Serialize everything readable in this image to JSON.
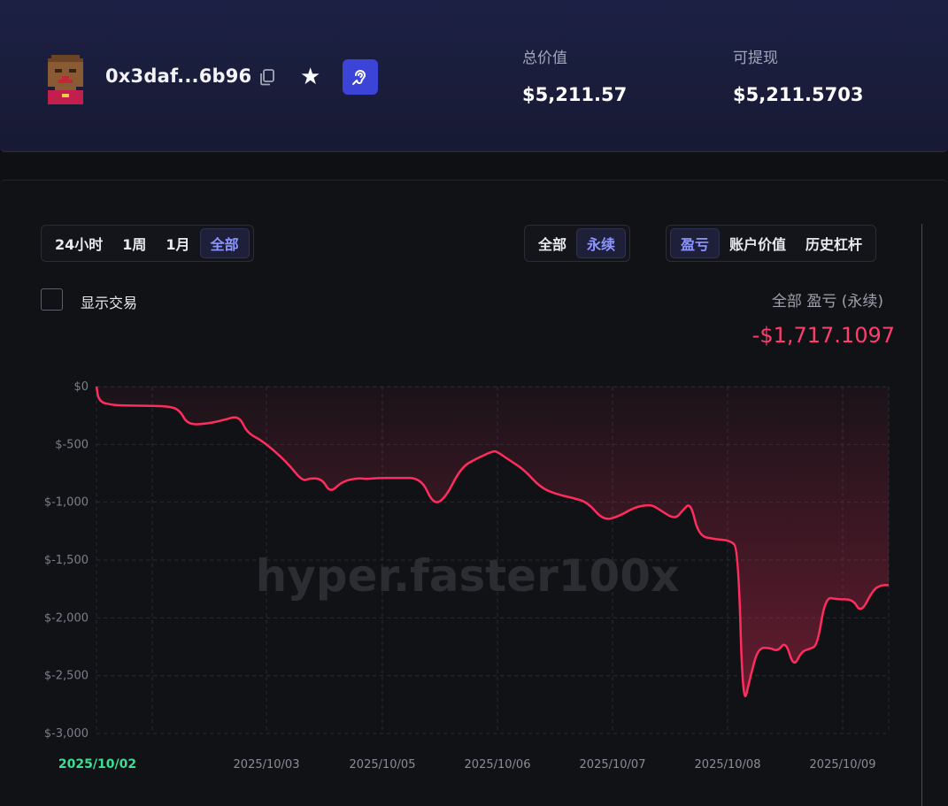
{
  "header": {
    "address": "0x3daf...6b96",
    "total_value_label": "总价值",
    "total_value": "$5,211.57",
    "withdrawable_label": "可提现",
    "withdrawable": "$5,211.5703"
  },
  "icons": {
    "copy": "copy-icon",
    "star": "star-icon",
    "ear": "ear-icon",
    "avatar": "pixel-avatar"
  },
  "controls": {
    "time_ranges": [
      "24小时",
      "1周",
      "1月",
      "全部"
    ],
    "time_active": "全部",
    "market_types": [
      "全部",
      "永续"
    ],
    "market_active": "永续",
    "metrics": [
      "盈亏",
      "账户价值",
      "历史杠杆"
    ],
    "metric_active": "盈亏",
    "show_trades_label": "显示交易"
  },
  "summary": {
    "caption": "全部 盈亏 (永续)",
    "value": "-$1,717.1097"
  },
  "colors": {
    "accent": "#3b44d6",
    "active_text": "#8d96ff",
    "negative": "#ff2d5e",
    "first_date": "#3ddc97"
  },
  "chart_data": {
    "type": "area",
    "title": "",
    "xlabel": "",
    "ylabel": "",
    "watermark": "hyper.faster100x",
    "ylim": [
      -3000,
      0
    ],
    "y_ticks": [
      "$0",
      "$-500",
      "$-1,000",
      "$-1,500",
      "$-2,000",
      "$-2,500",
      "$-3,000"
    ],
    "x_ticks": [
      "2025/10/02",
      "2025/10/03",
      "2025/10/05",
      "2025/10/06",
      "2025/10/07",
      "2025/10/08",
      "2025/10/09"
    ],
    "grid": true,
    "series": [
      {
        "values": [
          [
            0.0,
            0
          ],
          [
            0.003,
            -130
          ],
          [
            0.02,
            -160
          ],
          [
            0.05,
            -165
          ],
          [
            0.09,
            -168
          ],
          [
            0.105,
            -200
          ],
          [
            0.115,
            -330
          ],
          [
            0.14,
            -320
          ],
          [
            0.16,
            -290
          ],
          [
            0.18,
            -250
          ],
          [
            0.19,
            -400
          ],
          [
            0.21,
            -470
          ],
          [
            0.24,
            -650
          ],
          [
            0.26,
            -820
          ],
          [
            0.27,
            -790
          ],
          [
            0.285,
            -800
          ],
          [
            0.295,
            -920
          ],
          [
            0.31,
            -820
          ],
          [
            0.33,
            -790
          ],
          [
            0.34,
            -800
          ],
          [
            0.355,
            -790
          ],
          [
            0.38,
            -790
          ],
          [
            0.41,
            -790
          ],
          [
            0.425,
            -1020
          ],
          [
            0.44,
            -970
          ],
          [
            0.46,
            -700
          ],
          [
            0.48,
            -620
          ],
          [
            0.5,
            -560
          ],
          [
            0.505,
            -560
          ],
          [
            0.52,
            -630
          ],
          [
            0.54,
            -720
          ],
          [
            0.56,
            -870
          ],
          [
            0.58,
            -930
          ],
          [
            0.6,
            -960
          ],
          [
            0.62,
            -1000
          ],
          [
            0.64,
            -1160
          ],
          [
            0.66,
            -1120
          ],
          [
            0.68,
            -1040
          ],
          [
            0.7,
            -1020
          ],
          [
            0.71,
            -1060
          ],
          [
            0.73,
            -1150
          ],
          [
            0.74,
            -1070
          ],
          [
            0.75,
            -1000
          ],
          [
            0.76,
            -1290
          ],
          [
            0.78,
            -1320
          ],
          [
            0.8,
            -1330
          ],
          [
            0.81,
            -1400
          ],
          [
            0.816,
            -2790
          ],
          [
            0.825,
            -2520
          ],
          [
            0.835,
            -2260
          ],
          [
            0.85,
            -2260
          ],
          [
            0.86,
            -2290
          ],
          [
            0.87,
            -2200
          ],
          [
            0.88,
            -2430
          ],
          [
            0.89,
            -2290
          ],
          [
            0.9,
            -2270
          ],
          [
            0.91,
            -2240
          ],
          [
            0.92,
            -1820
          ],
          [
            0.935,
            -1840
          ],
          [
            0.955,
            -1840
          ],
          [
            0.965,
            -1960
          ],
          [
            0.98,
            -1760
          ],
          [
            0.99,
            -1717
          ],
          [
            1.0,
            -1717
          ]
        ]
      }
    ]
  }
}
